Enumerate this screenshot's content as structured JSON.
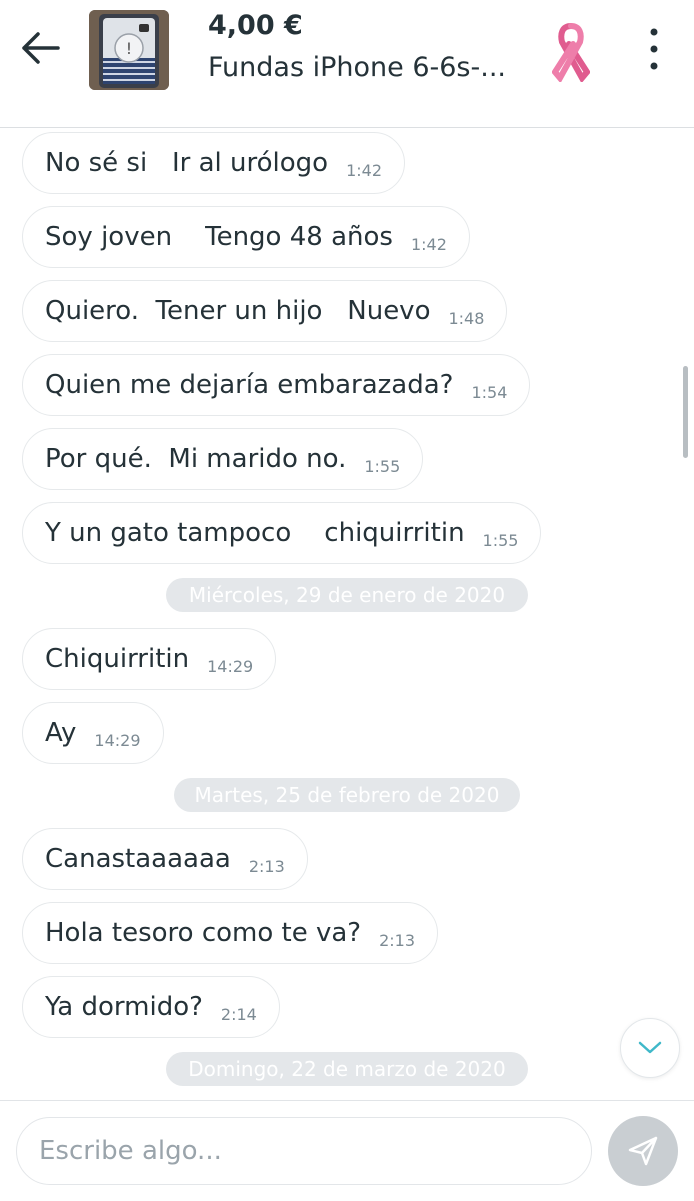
{
  "header": {
    "price": "4,00 €",
    "title": "Fundas iPhone 6-6s-...",
    "back_icon": "arrow-left-icon",
    "menu_icon": "more-vertical-icon",
    "badge_icon": "pink-ribbon-icon",
    "ribbon_color": "#e05c8f"
  },
  "messages": [
    {
      "text": "No sé si   Ir al urólogo",
      "time": "1:42"
    },
    {
      "text": "Soy joven    Tengo 48 años",
      "time": "1:42"
    },
    {
      "text": "Quiero.  Tener un hijo   Nuevo",
      "time": "1:48"
    },
    {
      "text": "Quien me dejaría embarazada?",
      "time": "1:54"
    },
    {
      "text": "Por qué.  Mi marido no.",
      "time": "1:55"
    },
    {
      "text": "Y un gato tampoco    chiquirritin",
      "time": "1:55"
    },
    {
      "text": "Chiquirritin",
      "time": "14:29"
    },
    {
      "text": "Ay",
      "time": "14:29"
    },
    {
      "text": "Canastaaaaaa",
      "time": "2:13"
    },
    {
      "text": "Hola tesoro como te va?",
      "time": "2:13"
    },
    {
      "text": "Ya dormido?",
      "time": "2:14"
    }
  ],
  "separators": [
    "Miércoles, 29 de enero de 2020",
    "Martes, 25 de febrero de 2020",
    "Domingo, 22 de marzo de 2020"
  ],
  "composer": {
    "placeholder": "Escribe algo...",
    "send_icon": "send-icon"
  },
  "scroll_down_icon": "chevron-down-icon"
}
